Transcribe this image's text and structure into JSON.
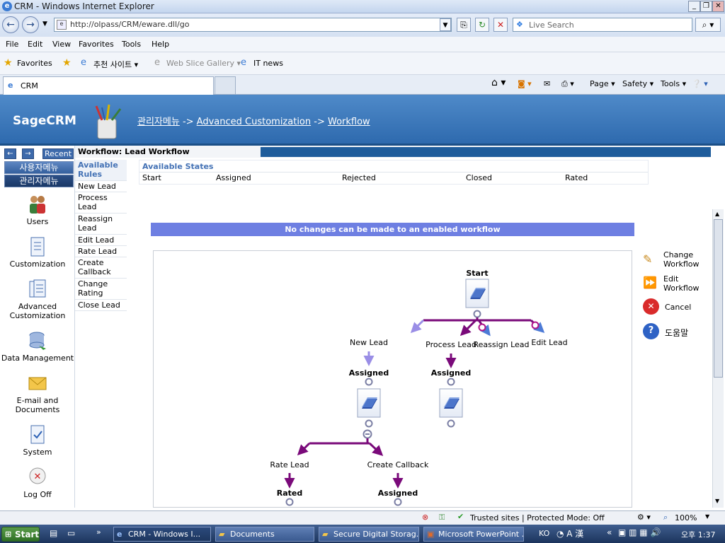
{
  "window": {
    "title": "CRM   - Windows Internet Explorer"
  },
  "address": {
    "url": "http://olpass/CRM/eware.dll/go",
    "search_placeholder": "Live Search"
  },
  "menu": [
    "File",
    "Edit",
    "View",
    "Favorites",
    "Tools",
    "Help"
  ],
  "favorites_bar": {
    "favorites": "Favorites",
    "korean_sites": "추천 사이트 ▾",
    "web_slice": "Web Slice Gallery ▾",
    "it_news": "IT news"
  },
  "tab": {
    "label": "CRM"
  },
  "command_bar": {
    "page": "Page ▾",
    "safety": "Safety ▾",
    "tools": "Tools ▾"
  },
  "crm": {
    "logo": "SageCRM",
    "breadcrumb": {
      "admin": "관리자메뉴",
      "sep1": " -> ",
      "advanced": "Advanced Customization",
      "sep2": " -> ",
      "workflow": "Workflow"
    },
    "nav": {
      "recent": "Recent",
      "user_menu": "사용자메뉴",
      "admin_menu": "관리자메뉴"
    },
    "nav_items": [
      "Users",
      "Customization",
      "Advanced Customization",
      "Data Management",
      "E-mail and Documents",
      "System",
      "Log Off"
    ],
    "workflow_title": "Workflow: Lead Workflow",
    "rules_header": "Available Rules",
    "rules": [
      "New Lead",
      "Process Lead",
      "Reassign Lead",
      "Edit Lead",
      "Rate Lead",
      "Create Callback",
      "Change Rating",
      "Close Lead"
    ],
    "states_header": "Available States",
    "states": [
      "Start",
      "Assigned",
      "Rejected",
      "Closed",
      "Rated"
    ],
    "banner": "No changes can be made to an enabled workflow",
    "diagram": {
      "start": "Start",
      "new_lead": "New Lead",
      "process_lead": "Process Lead",
      "reassign_lead": "Reassign Lead",
      "edit_lead": "Edit Lead",
      "assigned": "Assigned",
      "rate_lead": "Rate Lead",
      "create_callback": "Create Callback",
      "rated": "Rated"
    },
    "actions": {
      "change_workflow": "Change Workflow",
      "edit_workflow": "Edit Workflow",
      "cancel": "Cancel",
      "help": "도움말"
    }
  },
  "status": {
    "zone": "Trusted sites | Protected Mode: Off",
    "zoom": "100%"
  },
  "taskbar": {
    "start": "Start",
    "items": [
      "CRM   - Windows I...",
      "Documents",
      "Secure Digital Storag...",
      "Microsoft PowerPoint ..."
    ],
    "lang": "KO",
    "clock": "오후 1:37"
  },
  "colors": {
    "header_blue": "#2e6aae",
    "banner": "#6e7fe2",
    "flow_purple": "#7a0a7a",
    "flow_light": "#9a8ee6"
  }
}
